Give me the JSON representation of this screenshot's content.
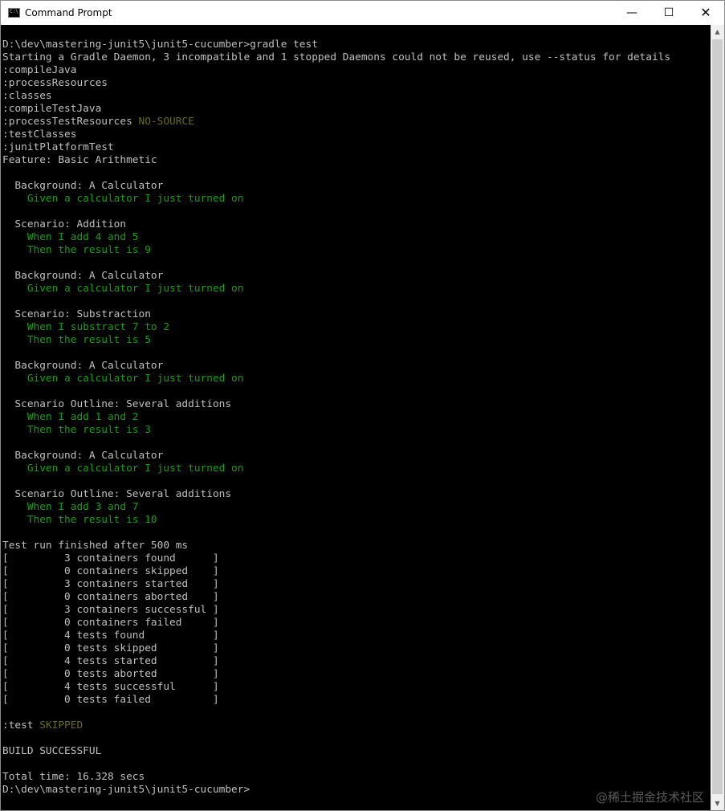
{
  "window": {
    "title": "Command Prompt",
    "icon_label": "C:\\",
    "controls": {
      "minimize": "—",
      "maximize": "☐",
      "close": "✕"
    }
  },
  "colors": {
    "background": "#000000",
    "text": "#c0c0c0",
    "success_green": "#13a10e",
    "skip_olive": "#6b6b1f"
  },
  "console": {
    "lines": [
      [
        {
          "t": "D:\\dev\\mastering-junit5\\junit5-cucumber>gradle test",
          "c": "gray"
        }
      ],
      [
        {
          "t": "Starting a Gradle Daemon, 3 incompatible and 1 stopped Daemons could not be reused, use --status for details",
          "c": "gray"
        }
      ],
      [
        {
          "t": ":compileJava",
          "c": "gray"
        }
      ],
      [
        {
          "t": ":processResources",
          "c": "gray"
        }
      ],
      [
        {
          "t": ":classes",
          "c": "gray"
        }
      ],
      [
        {
          "t": ":compileTestJava",
          "c": "gray"
        }
      ],
      [
        {
          "t": ":processTestResources ",
          "c": "gray"
        },
        {
          "t": "NO-SOURCE",
          "c": "olive"
        }
      ],
      [
        {
          "t": ":testClasses",
          "c": "gray"
        }
      ],
      [
        {
          "t": ":junitPlatformTest",
          "c": "gray"
        }
      ],
      [
        {
          "t": "Feature: Basic Arithmetic",
          "c": "gray"
        }
      ],
      [
        {
          "t": "",
          "c": "gray"
        }
      ],
      [
        {
          "t": "  Background: A Calculator",
          "c": "gray"
        }
      ],
      [
        {
          "t": "    Given a calculator I just turned on",
          "c": "green"
        }
      ],
      [
        {
          "t": "",
          "c": "gray"
        }
      ],
      [
        {
          "t": "  Scenario: Addition",
          "c": "gray"
        }
      ],
      [
        {
          "t": "    When I add 4 and 5",
          "c": "green"
        }
      ],
      [
        {
          "t": "    Then the result is 9",
          "c": "green"
        }
      ],
      [
        {
          "t": "",
          "c": "gray"
        }
      ],
      [
        {
          "t": "  Background: A Calculator",
          "c": "gray"
        }
      ],
      [
        {
          "t": "    Given a calculator I just turned on",
          "c": "green"
        }
      ],
      [
        {
          "t": "",
          "c": "gray"
        }
      ],
      [
        {
          "t": "  Scenario: Substraction",
          "c": "gray"
        }
      ],
      [
        {
          "t": "    When I substract 7 to 2",
          "c": "green"
        }
      ],
      [
        {
          "t": "    Then the result is 5",
          "c": "green"
        }
      ],
      [
        {
          "t": "",
          "c": "gray"
        }
      ],
      [
        {
          "t": "  Background: A Calculator",
          "c": "gray"
        }
      ],
      [
        {
          "t": "    Given a calculator I just turned on",
          "c": "green"
        }
      ],
      [
        {
          "t": "",
          "c": "gray"
        }
      ],
      [
        {
          "t": "  Scenario Outline: Several additions",
          "c": "gray"
        }
      ],
      [
        {
          "t": "    When I add 1 and 2",
          "c": "green"
        }
      ],
      [
        {
          "t": "    Then the result is 3",
          "c": "green"
        }
      ],
      [
        {
          "t": "",
          "c": "gray"
        }
      ],
      [
        {
          "t": "  Background: A Calculator",
          "c": "gray"
        }
      ],
      [
        {
          "t": "    Given a calculator I just turned on",
          "c": "green"
        }
      ],
      [
        {
          "t": "",
          "c": "gray"
        }
      ],
      [
        {
          "t": "  Scenario Outline: Several additions",
          "c": "gray"
        }
      ],
      [
        {
          "t": "    When I add 3 and 7",
          "c": "green"
        }
      ],
      [
        {
          "t": "    Then the result is 10",
          "c": "green"
        }
      ],
      [
        {
          "t": "",
          "c": "gray"
        }
      ],
      [
        {
          "t": "Test run finished after 500 ms",
          "c": "gray"
        }
      ],
      [
        {
          "t": "[         3 containers found      ]",
          "c": "gray"
        }
      ],
      [
        {
          "t": "[         0 containers skipped    ]",
          "c": "gray"
        }
      ],
      [
        {
          "t": "[         3 containers started    ]",
          "c": "gray"
        }
      ],
      [
        {
          "t": "[         0 containers aborted    ]",
          "c": "gray"
        }
      ],
      [
        {
          "t": "[         3 containers successful ]",
          "c": "gray"
        }
      ],
      [
        {
          "t": "[         0 containers failed     ]",
          "c": "gray"
        }
      ],
      [
        {
          "t": "[         4 tests found           ]",
          "c": "gray"
        }
      ],
      [
        {
          "t": "[         0 tests skipped         ]",
          "c": "gray"
        }
      ],
      [
        {
          "t": "[         4 tests started         ]",
          "c": "gray"
        }
      ],
      [
        {
          "t": "[         0 tests aborted         ]",
          "c": "gray"
        }
      ],
      [
        {
          "t": "[         4 tests successful      ]",
          "c": "gray"
        }
      ],
      [
        {
          "t": "[         0 tests failed          ]",
          "c": "gray"
        }
      ],
      [
        {
          "t": "",
          "c": "gray"
        }
      ],
      [
        {
          "t": ":test ",
          "c": "gray"
        },
        {
          "t": "SKIPPED",
          "c": "olive"
        }
      ],
      [
        {
          "t": "",
          "c": "gray"
        }
      ],
      [
        {
          "t": "BUILD SUCCESSFUL",
          "c": "gray"
        }
      ],
      [
        {
          "t": "",
          "c": "gray"
        }
      ],
      [
        {
          "t": "Total time: 16.328 secs",
          "c": "gray"
        }
      ],
      [
        {
          "t": "D:\\dev\\mastering-junit5\\junit5-cucumber>",
          "c": "gray"
        }
      ]
    ]
  },
  "scrollbar": {
    "up_arrow": "▲",
    "down_arrow": "▼"
  },
  "watermark": "@稀土掘金技术社区"
}
